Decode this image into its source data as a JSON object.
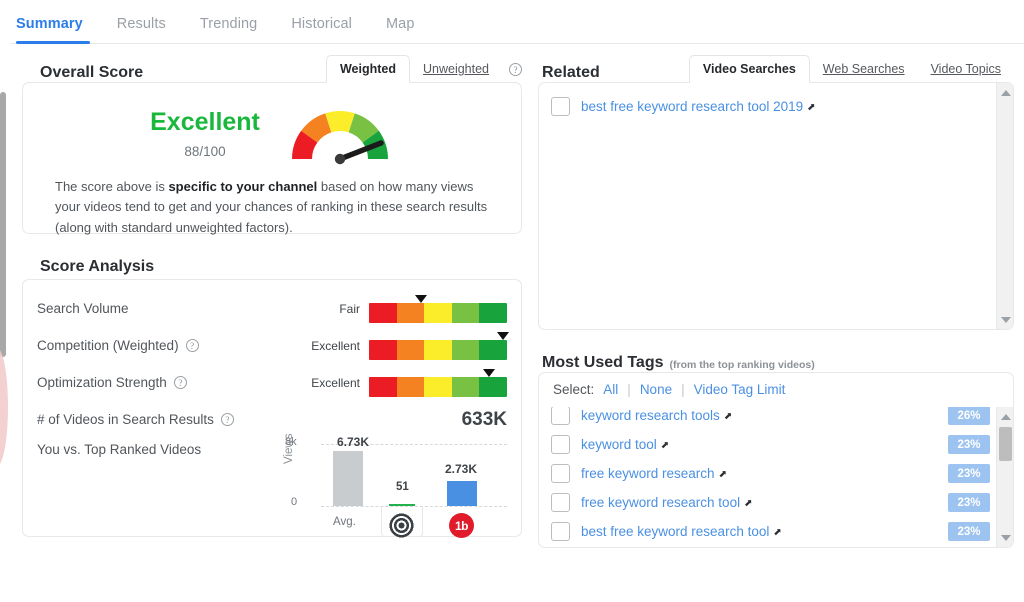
{
  "tabs": [
    {
      "label": "Summary",
      "active": true
    },
    {
      "label": "Results",
      "active": false
    },
    {
      "label": "Trending",
      "active": false
    },
    {
      "label": "Historical",
      "active": false
    },
    {
      "label": "Map",
      "active": false
    }
  ],
  "overall": {
    "title": "Overall Score",
    "tab_weighted": "Weighted",
    "tab_unweighted": "Unweighted",
    "help_icon": "question-mark-icon",
    "score_word": "Excellent",
    "score_value": "88/100",
    "score_color": "#19b83c",
    "gauge_icon": "gauge-icon",
    "desc_pre": "The score above is ",
    "desc_bold": "specific to your channel",
    "desc_post": " based on how many views your videos tend to get and your chances of ranking in these search results (along with standard unweighted factors)."
  },
  "analysis": {
    "title": "Score Analysis",
    "rows": [
      {
        "label": "Search Volume",
        "grade": "Fair",
        "marker_pct": 38,
        "has_help": false
      },
      {
        "label": "Competition (Weighted)",
        "grade": "Excellent",
        "marker_pct": 97,
        "has_help": true
      },
      {
        "label": "Optimization Strength",
        "grade": "Excellent",
        "marker_pct": 87,
        "has_help": true
      }
    ],
    "videos_label": "# of Videos in Search Results",
    "videos_value": "633K",
    "videos_has_help": true,
    "compare_label": "You vs. Top Ranked Videos"
  },
  "chart_data": {
    "type": "bar",
    "title": "You vs. Top Ranked Videos",
    "xlabel": "",
    "ylabel": "Views",
    "ylim": [
      0,
      8000
    ],
    "ytick_labels": [
      "8k",
      "0"
    ],
    "categories": [
      "Avg.",
      "target",
      "tubebuddy"
    ],
    "category_icons": [
      "",
      "target-icon",
      "tubebuddy-icon"
    ],
    "values": [
      6730,
      51,
      2730
    ],
    "value_labels": [
      "6.73K",
      "51",
      "2.73K"
    ],
    "bar_colors": [
      "#c9cccf",
      "#22b14c",
      "#4a90e2"
    ],
    "grid": true,
    "legend": "none"
  },
  "related": {
    "title": "Related",
    "tabs": [
      {
        "label": "Video Searches",
        "active": true
      },
      {
        "label": "Web Searches",
        "active": false
      },
      {
        "label": "Video Topics",
        "active": false
      }
    ],
    "items": [
      {
        "text": "best free keyword research tool 2019",
        "checked": false
      }
    ],
    "scroll_up_icon": "scroll-up-arrow-icon",
    "scroll_down_icon": "scroll-down-arrow-icon"
  },
  "tags": {
    "title": "Most Used Tags",
    "subtitle": "(from the top ranking videos)",
    "select_label": "Select:",
    "select_all": "All",
    "select_none": "None",
    "select_limit": "Video Tag Limit",
    "items": [
      {
        "text": "keyword research tools",
        "pct": "26%",
        "checked": false
      },
      {
        "text": "keyword tool",
        "pct": "23%",
        "checked": false
      },
      {
        "text": "free keyword research",
        "pct": "23%",
        "checked": false
      },
      {
        "text": "free keyword research tool",
        "pct": "23%",
        "checked": false
      },
      {
        "text": "best free keyword research tool",
        "pct": "23%",
        "checked": false
      }
    ]
  },
  "icons": {
    "external_link": "↗"
  },
  "colors": {
    "accent": "#2b7de9",
    "link": "#4a90e2",
    "good": "#19b83c",
    "meter": [
      "#ec1c24",
      "#f58220",
      "#fced2a",
      "#79c143",
      "#19a33c"
    ]
  }
}
